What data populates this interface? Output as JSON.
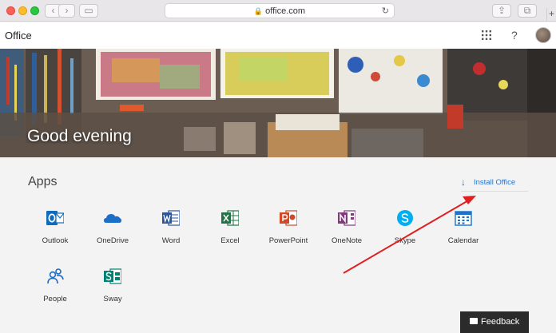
{
  "browser": {
    "url": "office.com",
    "back_glyph": "‹",
    "forward_glyph": "›",
    "sidebar_glyph": "▭",
    "reload_glyph": "↻",
    "lock_glyph": "🔒",
    "share_glyph": "⇪",
    "tabs_glyph": "⧉",
    "newtab_glyph": "+"
  },
  "header": {
    "title": "Office",
    "apps_glyph": "⋮⋮⋮",
    "help_glyph": "?"
  },
  "banner": {
    "greeting": "Good evening"
  },
  "apps_section": {
    "title": "Apps",
    "install_label": "Install Office",
    "install_glyph": "↓",
    "apps": [
      {
        "label": "Outlook",
        "icon": "outlook-icon",
        "color": "#0f6cbd"
      },
      {
        "label": "OneDrive",
        "icon": "onedrive-icon",
        "color": "#1b6fc7"
      },
      {
        "label": "Word",
        "icon": "word-icon",
        "color": "#2b579a"
      },
      {
        "label": "Excel",
        "icon": "excel-icon",
        "color": "#217346"
      },
      {
        "label": "PowerPoint",
        "icon": "powerpoint-icon",
        "color": "#d24726"
      },
      {
        "label": "OneNote",
        "icon": "onenote-icon",
        "color": "#80397b"
      },
      {
        "label": "Skype",
        "icon": "skype-icon",
        "color": "#00aff0"
      },
      {
        "label": "Calendar",
        "icon": "calendar-icon",
        "color": "#1a73c9"
      },
      {
        "label": "People",
        "icon": "people-icon",
        "color": "#1f6bc0"
      },
      {
        "label": "Sway",
        "icon": "sway-icon",
        "color": "#008272"
      }
    ]
  },
  "feedback": {
    "label": "Feedback"
  },
  "annotation_color": "#e02020"
}
